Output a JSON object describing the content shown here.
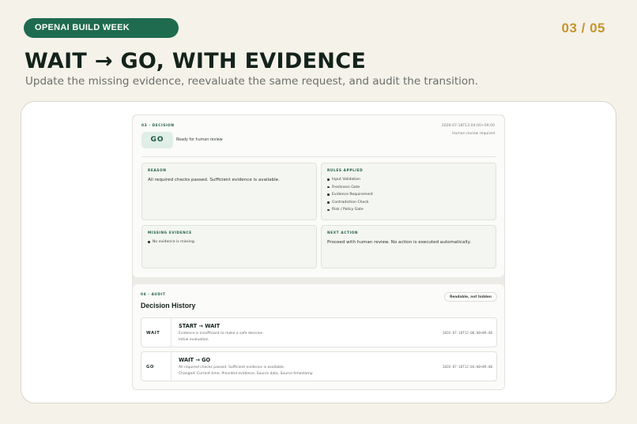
{
  "header": {
    "pill_label": "OPENAI BUILD WEEK",
    "page_counter": "03 / 05",
    "title": "WAIT → GO, WITH EVIDENCE",
    "subtitle": "Update the missing evidence, reevaluate the same request, and audit the transition."
  },
  "decision": {
    "kicker": "03 · DECISION",
    "verdict": "GO",
    "status_text": "Ready for human review",
    "timestamp": "2026-07-18T12:04:00+09:00",
    "review_note": "Human review required",
    "reason": {
      "label": "REASON",
      "text": "All required checks passed. Sufficient evidence is available."
    },
    "rules": {
      "label": "RULES APPLIED",
      "items": [
        "Input Validation",
        "Freshness Gate",
        "Evidence Requirement",
        "Contradiction Check",
        "Risk / Policy Gate"
      ]
    },
    "missing": {
      "label": "MISSING EVIDENCE",
      "items": [
        "No evidence is missing"
      ]
    },
    "next_action": {
      "label": "NEXT ACTION",
      "text": "Proceed with human review. No action is executed automatically."
    }
  },
  "audit": {
    "kicker": "04 · AUDIT",
    "title": "Decision History",
    "badge": "Readable, not hidden",
    "rows": [
      {
        "state": "WAIT",
        "transition": "START → WAIT",
        "detail": "Evidence is insufficient to make a safe decision.",
        "note": "Initial evaluation",
        "timestamp": "2026-07-18T12:00:00+09:00"
      },
      {
        "state": "GO",
        "transition": "WAIT → GO",
        "detail": "All required checks passed. Sufficient evidence is available.",
        "note": "Changed: Current time, Provided evidence, Source data, Source timestamp",
        "timestamp": "2026-07-18T12:04:00+09:00"
      }
    ]
  }
}
